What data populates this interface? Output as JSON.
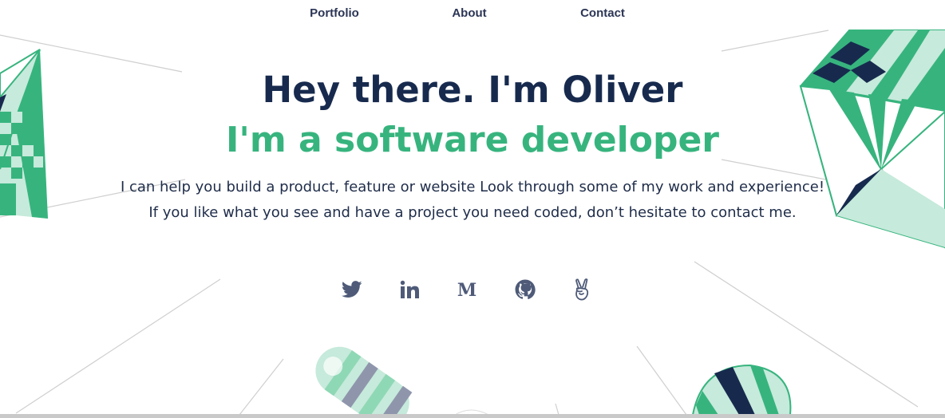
{
  "nav": {
    "portfolio": "Portfolio",
    "about": "About",
    "contact": "Contact"
  },
  "hero": {
    "title": "Hey there. I'm Oliver",
    "subtitle": "I'm a software developer",
    "line1": "I can help you build a product, feature or website Look through some of my work and experience!",
    "line2": "If you like what you see and have a project you need coded, don’t hesitate to contact me."
  },
  "socials": [
    {
      "icon": "twitter-icon"
    },
    {
      "icon": "linkedin-icon"
    },
    {
      "icon": "medium-icon"
    },
    {
      "icon": "github-icon"
    },
    {
      "icon": "angellist-icon"
    }
  ],
  "colors": {
    "navy": "#172a4e",
    "green": "#37b47e",
    "light_green": "#c6eadb",
    "icon": "#4e5a78"
  }
}
